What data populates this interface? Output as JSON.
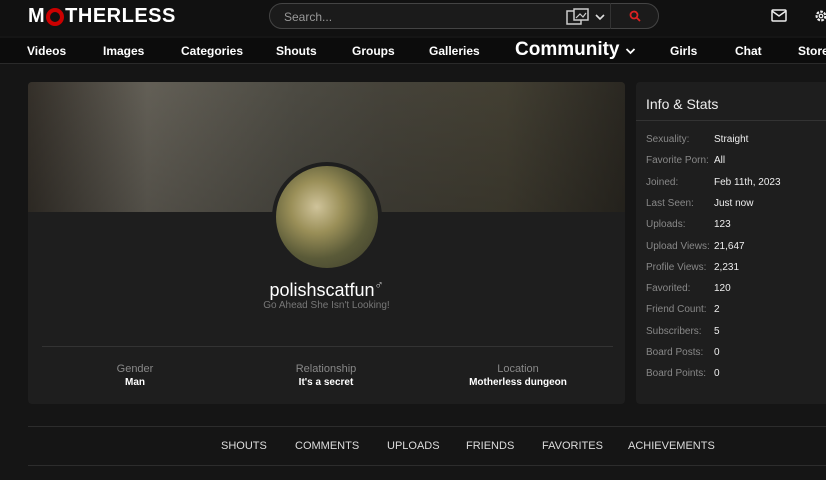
{
  "header": {
    "logo_text": "M THERLESS",
    "search_placeholder": "Search...",
    "icons": [
      "media-type-icon",
      "chevron-down-icon",
      "search-icon",
      "mail-icon",
      "gear-icon"
    ]
  },
  "nav": [
    "Videos",
    "Images",
    "Categories",
    "Shouts",
    "Groups",
    "Galleries",
    "Community",
    "Girls",
    "Chat",
    "Store"
  ],
  "profile": {
    "username": "polishscatfun",
    "gender_symbol": "♂",
    "tagline": "Go Ahead She Isn't Looking!",
    "props": [
      {
        "label": "Gender",
        "value": "Man"
      },
      {
        "label": "Relationship",
        "value": "It's a secret"
      },
      {
        "label": "Location",
        "value": "Motherless dungeon"
      }
    ]
  },
  "stats": {
    "title": "Info & Stats",
    "rows": [
      {
        "k": "Sexuality:",
        "v": "Straight"
      },
      {
        "k": "Favorite Porn:",
        "v": "All"
      },
      {
        "k": "Joined:",
        "v": "Feb 11th, 2023"
      },
      {
        "k": "Last Seen:",
        "v": "Just now"
      },
      {
        "k": "Uploads:",
        "v": "123"
      },
      {
        "k": "Upload Views:",
        "v": "21,647"
      },
      {
        "k": "Profile Views:",
        "v": "2,231"
      },
      {
        "k": "Favorited:",
        "v": "120"
      },
      {
        "k": "Friend Count:",
        "v": "2"
      },
      {
        "k": "Subscribers:",
        "v": "5"
      },
      {
        "k": "Board Posts:",
        "v": "0"
      },
      {
        "k": "Board Points:",
        "v": "0"
      }
    ]
  },
  "tabs": [
    "SHOUTS",
    "COMMENTS",
    "UPLOADS",
    "FRIENDS",
    "FAVORITES",
    "ACHIEVEMENTS"
  ],
  "colors": {
    "accent": "#cc0000"
  }
}
